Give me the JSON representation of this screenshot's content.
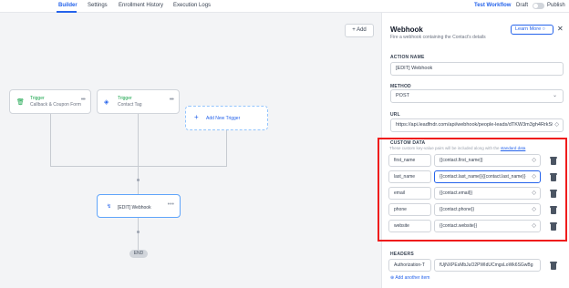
{
  "nav": {
    "tabs": [
      "Builder",
      "Settings",
      "Enrollment History",
      "Execution Logs"
    ],
    "test_workflow": "Test Workflow",
    "draft": "Draft",
    "publish": "Publish"
  },
  "canvas": {
    "add_button": "+ Add",
    "triggers": [
      {
        "title": "Trigger",
        "subtitle": "Callback & Coupon Form",
        "icon": "form-icon"
      },
      {
        "title": "Trigger",
        "subtitle": "Contact Tag",
        "icon": "tag-icon"
      }
    ],
    "add_trigger": "Add New Trigger",
    "action": {
      "label": "[EDIT] Webhook",
      "icon": "webhook-icon"
    },
    "end": "END"
  },
  "panel": {
    "title": "Webhook",
    "subtitle": "Fire a webhook containing the Contact's details",
    "learn_more": "Learn More",
    "action_name_label": "ACTION NAME",
    "action_name": "[EDIT] Webhook",
    "method_label": "METHOD",
    "method": "POST",
    "url_label": "URL",
    "url": "https://api.leadfndr.com/api/webhook/people-leads/dTKW3m3gh4RrkSt",
    "custom_data_label": "CUSTOM DATA",
    "custom_data_note": "These custom key-value pairs will be included along with the",
    "custom_data_link": "standard data",
    "custom_data": [
      {
        "key": "first_name",
        "value": "{{contact.first_name}}"
      },
      {
        "key": "last_name",
        "value": "{{contact.last_name}}{{contact.last_name}}"
      },
      {
        "key": "email",
        "value": "{{contact.email}}"
      },
      {
        "key": "phone",
        "value": "{{contact.phone}}"
      },
      {
        "key": "website",
        "value": "{{contact.website}}"
      }
    ],
    "headers_label": "HEADERS",
    "header_key": "Authorization-T",
    "header_value": "fUjNXPEsMbJuO2PWIdUCmgsLoWk6SGwBg",
    "add_another_item": "Add another item"
  },
  "colors": {
    "accent": "#2563eb",
    "highlight": "#ef1c1c",
    "trigger": "#16a34a"
  }
}
